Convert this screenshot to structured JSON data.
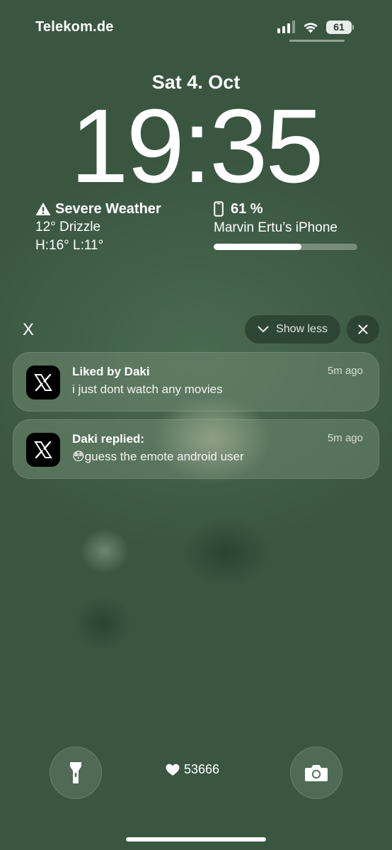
{
  "status_bar": {
    "carrier": "Telekom.de",
    "signal_bars": 4,
    "signal_active": 3,
    "wifi_icon": "wifi-icon",
    "battery_level": "61"
  },
  "lock_screen": {
    "date": "Sat 4. Oct",
    "time": "19:35"
  },
  "weather_widget": {
    "alert": "Severe Weather",
    "alert_icon": "warning-icon",
    "condition": "12° Drizzle",
    "high_low": "H:16° L:11°"
  },
  "battery_widget": {
    "icon": "phone-icon",
    "percent": "61 %",
    "device": "Marvin Ertu’s iPhone",
    "level_fraction": 0.61
  },
  "notifications": {
    "group_title": "X",
    "show_less_label": "Show less",
    "items": [
      {
        "app_icon": "x-logo-icon",
        "title": "Liked by Daki",
        "body": "i just dont watch any movies",
        "time": "5m ago"
      },
      {
        "app_icon": "x-logo-icon",
        "title": "Daki replied:",
        "body": "😳guess the emote android user",
        "time": "5m ago"
      }
    ]
  },
  "bottom": {
    "likes_count": "53666",
    "flashlight_icon": "flashlight-icon",
    "camera_icon": "camera-icon",
    "heart_icon": "heart-icon"
  },
  "colors": {
    "background": "#3a5641",
    "notification_bg": "rgba(120,145,120,0.45)"
  }
}
